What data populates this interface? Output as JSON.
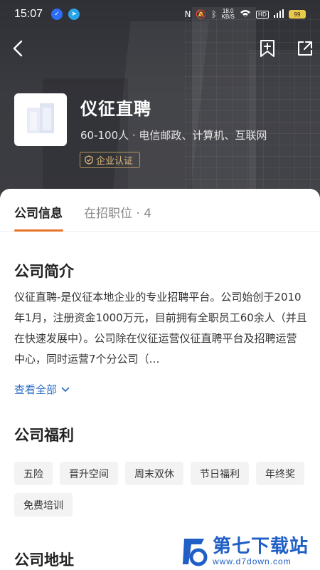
{
  "status_bar": {
    "time": "15:07",
    "net_speed_value": "18.0",
    "net_speed_unit": "KB/S",
    "network_label": "HD",
    "battery": "99"
  },
  "company": {
    "name": "仪征直聘",
    "meta": "60-100人 · 电信邮政、计算机、互联网",
    "certification": "企业认证"
  },
  "tabs": [
    {
      "label": "公司信息",
      "active": true
    },
    {
      "label": "在招职位 · 4",
      "active": false
    }
  ],
  "intro": {
    "title": "公司简介",
    "text": "仪征直聘-是仪征本地企业的专业招聘平台。公司始创于2010年1月，注册资金1000万元，目前拥有全职员工60余人（并且在快速发展中）。公司除在仪征运营仪征直聘平台及招聘运营中心，同时运营7个分公司（…",
    "view_all": "查看全部"
  },
  "benefits": {
    "title": "公司福利",
    "tags": [
      "五险",
      "晋升空间",
      "周末双休",
      "节日福利",
      "年终奖",
      "免费培训"
    ]
  },
  "address": {
    "title": "公司地址"
  },
  "watermark": {
    "title": "第七下载站",
    "url": "www.d7down.com"
  },
  "colors": {
    "accent": "#e8742a",
    "link": "#2f6fc8",
    "badge": "#d9b878",
    "hero_bg": "#3a3b40"
  },
  "icons": [
    "back-arrow-icon",
    "bookmark-add-icon",
    "share-icon",
    "shield-check-icon",
    "chevron-down-icon",
    "company-logo-icon"
  ]
}
